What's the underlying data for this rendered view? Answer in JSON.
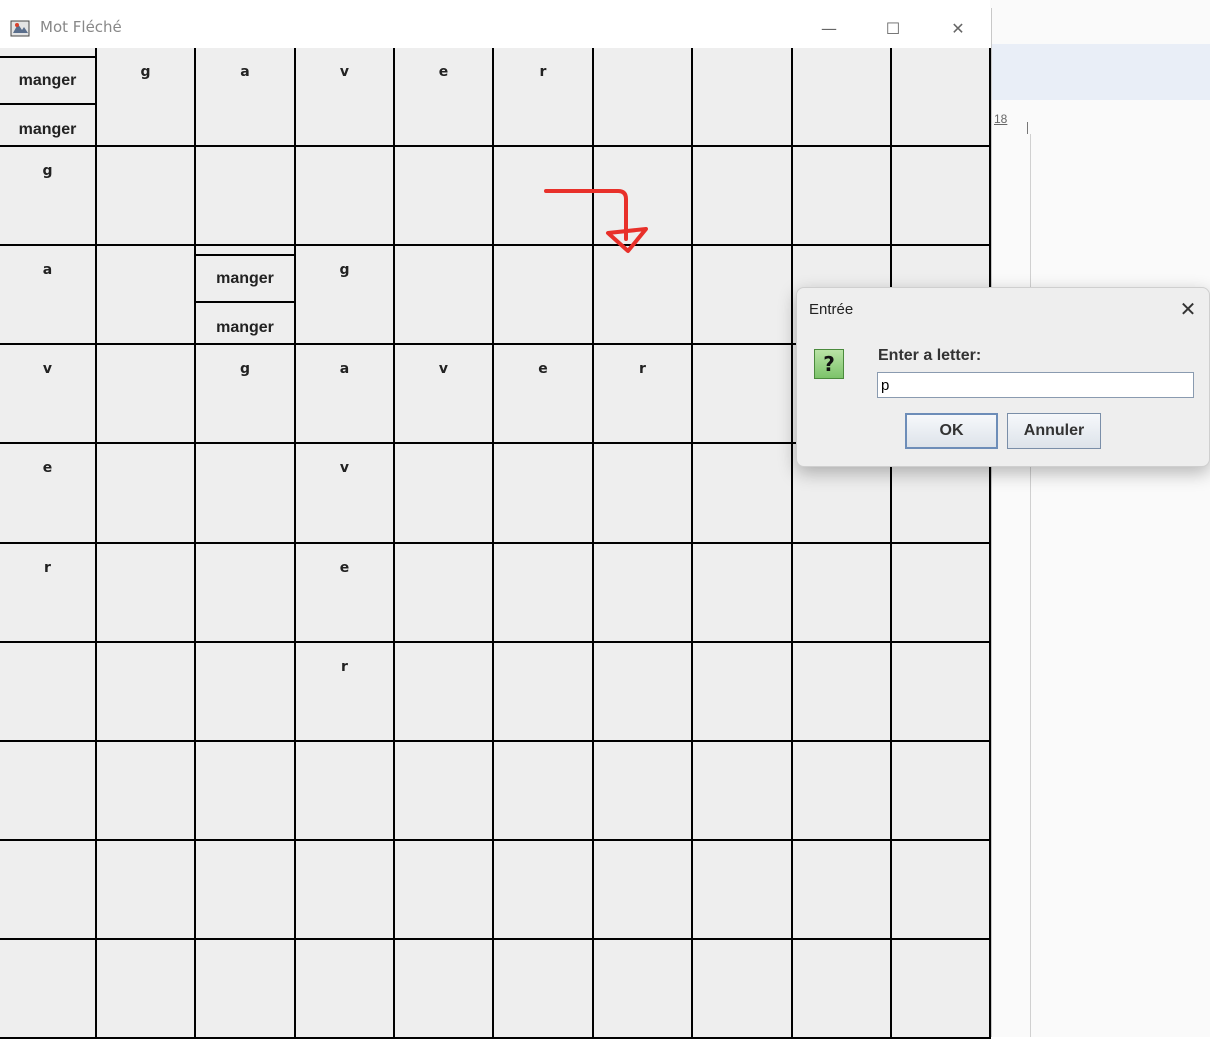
{
  "window": {
    "title": "Mot Fléché",
    "minimize_symbol": "—",
    "maximize_symbol": "☐",
    "close_symbol": "✕"
  },
  "background_app": {
    "ruler_number": "18"
  },
  "grid": {
    "rows": 10,
    "cols": 10,
    "clue_text": "manger",
    "clue_cells": [
      [
        0,
        0
      ],
      [
        2,
        2
      ]
    ],
    "letters": [
      {
        "r": 0,
        "c": 1,
        "t": "g"
      },
      {
        "r": 0,
        "c": 2,
        "t": "a"
      },
      {
        "r": 0,
        "c": 3,
        "t": "v"
      },
      {
        "r": 0,
        "c": 4,
        "t": "e"
      },
      {
        "r": 0,
        "c": 5,
        "t": "r"
      },
      {
        "r": 1,
        "c": 0,
        "t": "g"
      },
      {
        "r": 2,
        "c": 0,
        "t": "a"
      },
      {
        "r": 2,
        "c": 3,
        "t": "g"
      },
      {
        "r": 3,
        "c": 0,
        "t": "v"
      },
      {
        "r": 3,
        "c": 2,
        "t": "g"
      },
      {
        "r": 3,
        "c": 3,
        "t": "a"
      },
      {
        "r": 3,
        "c": 4,
        "t": "v"
      },
      {
        "r": 3,
        "c": 5,
        "t": "e"
      },
      {
        "r": 3,
        "c": 6,
        "t": "r"
      },
      {
        "r": 4,
        "c": 0,
        "t": "e"
      },
      {
        "r": 4,
        "c": 3,
        "t": "v"
      },
      {
        "r": 5,
        "c": 0,
        "t": "r"
      },
      {
        "r": 5,
        "c": 3,
        "t": "e"
      },
      {
        "r": 6,
        "c": 3,
        "t": "r"
      }
    ]
  },
  "annotation": {
    "arrow_color": "#e8302a"
  },
  "dialog": {
    "title": "Entrée",
    "close_symbol": "✕",
    "icon_glyph": "?",
    "prompt": "Enter a letter:",
    "input_value": "p",
    "ok_label": "OK",
    "cancel_label": "Annuler"
  }
}
